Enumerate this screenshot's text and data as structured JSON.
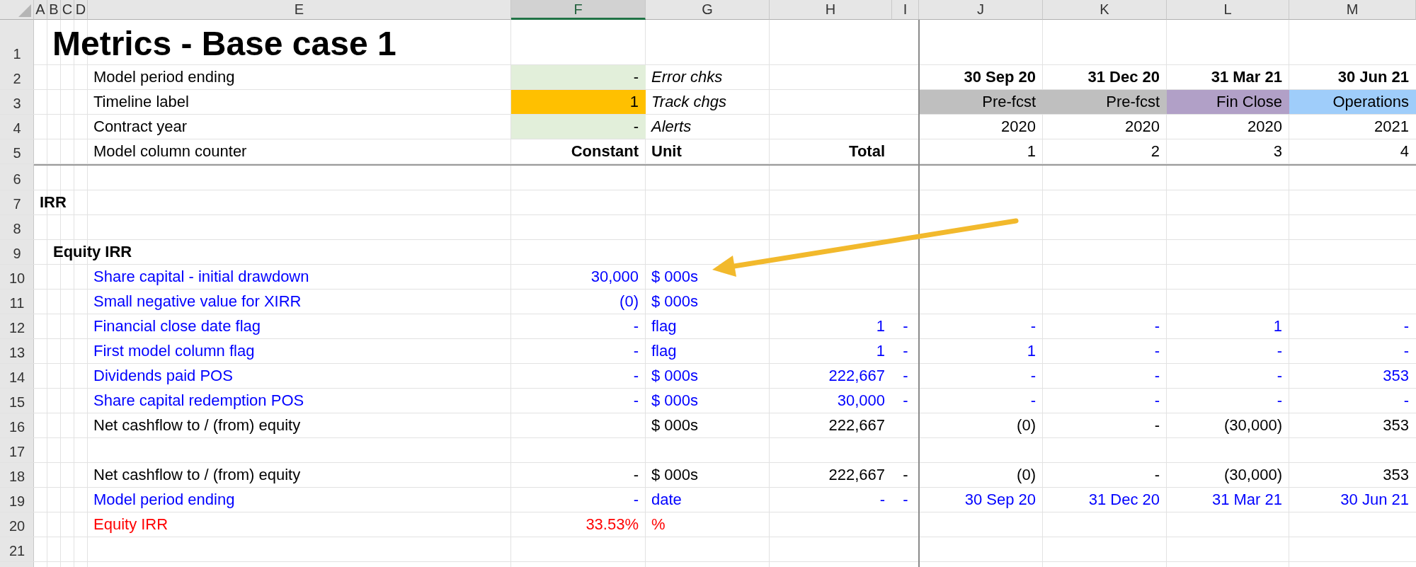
{
  "column_headers": [
    {
      "label": "A",
      "selected": false
    },
    {
      "label": "B",
      "selected": false
    },
    {
      "label": "C",
      "selected": false
    },
    {
      "label": "D",
      "selected": false
    },
    {
      "label": "E",
      "selected": false
    },
    {
      "label": "F",
      "selected": true
    },
    {
      "label": "G",
      "selected": false
    },
    {
      "label": "H",
      "selected": false
    },
    {
      "label": "I",
      "selected": false,
      "pane_split": true
    },
    {
      "label": "J",
      "selected": false
    },
    {
      "label": "K",
      "selected": false
    },
    {
      "label": "L",
      "selected": false
    },
    {
      "label": "M",
      "selected": false
    }
  ],
  "rows": [
    {
      "number": "1",
      "kind": "title",
      "heading": "Metrics - Base case 1"
    },
    {
      "number": "2",
      "kind": "setup",
      "label": "Model period ending",
      "constant": {
        "text": "-",
        "color": "#e2efda"
      },
      "unit": {
        "text": "Error chks",
        "kind": "italic"
      },
      "periods": [
        {
          "text": "30 Sep 20",
          "kind": "bold"
        },
        {
          "text": "31 Dec 20",
          "kind": "bold"
        },
        {
          "text": "31 Mar 21",
          "kind": "bold"
        },
        {
          "text": "30 Jun 21",
          "kind": "bold"
        }
      ]
    },
    {
      "number": "3",
      "kind": "setup",
      "label": "Timeline label",
      "constant": {
        "text": "1",
        "color": "#ffc000"
      },
      "unit": {
        "text": "Track chgs",
        "kind": "italic"
      },
      "periods": [
        {
          "text": "Pre-fcst",
          "color": "#bfbfbf"
        },
        {
          "text": "Pre-fcst",
          "color": "#bfbfbf"
        },
        {
          "text": "Fin Close",
          "color": "#b1a0c7"
        },
        {
          "text": "Operations",
          "color": "#9fcdfa"
        }
      ]
    },
    {
      "number": "4",
      "kind": "setup",
      "label": "Contract year",
      "constant": {
        "text": "-",
        "color": "#e2efda"
      },
      "unit": {
        "text": "Alerts",
        "kind": "italic"
      },
      "periods": [
        "2020",
        "2020",
        "2020",
        "2021"
      ]
    },
    {
      "number": "5",
      "kind": "setup",
      "divider_below": true,
      "label": "Model column counter",
      "constant": {
        "text": "Constant",
        "kind": "bold"
      },
      "unit": {
        "text": "Unit",
        "kind": "bold"
      },
      "total": {
        "text": "Total",
        "kind": "bold"
      },
      "periods": [
        "1",
        "2",
        "3",
        "4"
      ]
    },
    {
      "number": "6",
      "kind": "blank"
    },
    {
      "number": "7",
      "kind": "heading",
      "heading": "IRR"
    },
    {
      "number": "8",
      "kind": "blank"
    },
    {
      "number": "9",
      "kind": "subheading",
      "heading": "Equity IRR"
    },
    {
      "number": "10",
      "kind": "input",
      "label": "Share capital - initial drawdown",
      "constant": "30,000",
      "unit": "$ 000s"
    },
    {
      "number": "11",
      "kind": "input",
      "label": "Small negative value for XIRR",
      "constant": "(0)",
      "unit": "$ 000s"
    },
    {
      "number": "12",
      "kind": "input",
      "label": "Financial close date flag",
      "constant": "-",
      "unit": "flag",
      "total": "1",
      "check": "-",
      "periods": [
        "-",
        "-",
        "1",
        "-"
      ]
    },
    {
      "number": "13",
      "kind": "input",
      "label": "First model column flag",
      "constant": "-",
      "unit": "flag",
      "total": "1",
      "check": "-",
      "periods": [
        "1",
        "-",
        "-",
        "-"
      ]
    },
    {
      "number": "14",
      "kind": "input",
      "label": "Dividends paid POS",
      "constant": "-",
      "unit": "$ 000s",
      "total": "222,667",
      "check": "-",
      "periods": [
        "-",
        "-",
        "-",
        "353"
      ]
    },
    {
      "number": "15",
      "kind": "input",
      "label": "Share capital redemption POS",
      "constant": "-",
      "unit": "$ 000s",
      "total": "30,000",
      "check": "-",
      "periods": [
        "-",
        "-",
        "-",
        "-"
      ]
    },
    {
      "number": "16",
      "kind": "calc",
      "label": "Net cashflow to / (from) equity",
      "unit": "$ 000s",
      "total": "222,667",
      "periods": [
        "(0)",
        "-",
        "(30,000)",
        "353"
      ]
    },
    {
      "number": "17",
      "kind": "blank"
    },
    {
      "number": "18",
      "kind": "calc",
      "label": "Net cashflow to / (from) equity",
      "constant": "-",
      "unit": "$ 000s",
      "total": "222,667",
      "check": "-",
      "periods": [
        "(0)",
        "-",
        "(30,000)",
        "353"
      ]
    },
    {
      "number": "19",
      "kind": "input",
      "label": "Model period ending",
      "constant": "-",
      "unit": "date",
      "total": "-",
      "check": "-",
      "periods": [
        "30 Sep 20",
        "31 Dec 20",
        "31 Mar 21",
        "30 Jun 21"
      ]
    },
    {
      "number": "20",
      "kind": "result",
      "label": "Equity IRR",
      "constant": "33.53%",
      "unit": "%"
    },
    {
      "number": "21",
      "kind": "blank"
    }
  ]
}
